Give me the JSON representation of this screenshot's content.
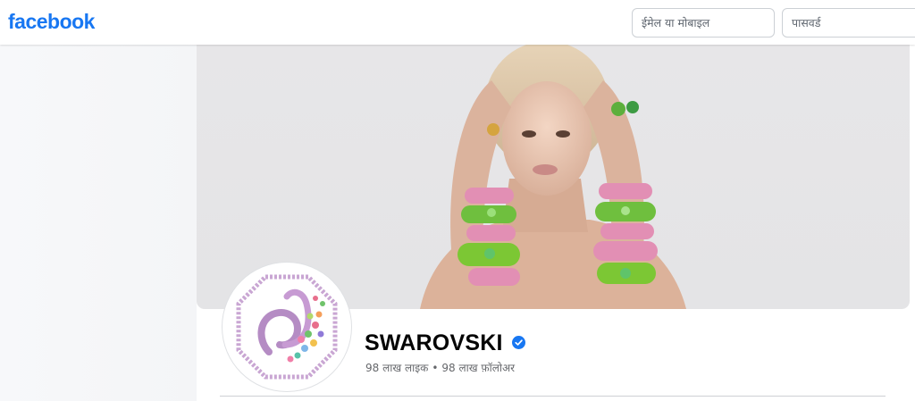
{
  "header": {
    "logo_text": "facebook",
    "email_placeholder": "ईमेल या मोबाइल",
    "password_placeholder": "पासवर्ड"
  },
  "profile": {
    "name": "SWAROVSKI",
    "verified": true,
    "likes": "98 लाख लाइक",
    "separator": "•",
    "followers": "98 लाख फ़ॉलोअर"
  },
  "colors": {
    "brand": "#1877f2",
    "verified_badge": "#1877f2",
    "page_background": "#ffffff"
  },
  "icons": {
    "verified": "verified-badge-icon"
  }
}
